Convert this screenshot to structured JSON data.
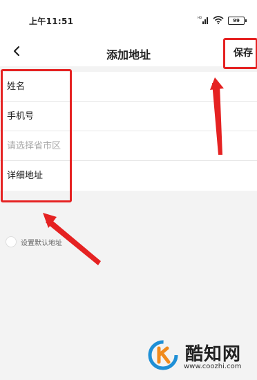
{
  "status_bar": {
    "time": "上午11:51",
    "network_label": "HD",
    "battery": "99",
    "icons": [
      "signal-icon",
      "wifi-icon",
      "battery-icon"
    ]
  },
  "nav": {
    "title": "添加地址",
    "save_label": "保存",
    "back_icon": "chevron-left-icon"
  },
  "form": {
    "name_label": "姓名",
    "phone_label": "手机号",
    "region_placeholder": "请选择省市区",
    "detail_label": "详细地址"
  },
  "default_address": {
    "label": "设置默认地址",
    "checked": false
  },
  "watermark": {
    "name": "酷知网",
    "url": "www.coozhi.com"
  },
  "colors": {
    "annotation_red": "#e52222",
    "page_bg": "#f3f3f3",
    "watermark_blue": "#1e8fd6",
    "watermark_orange": "#f08a1c"
  }
}
